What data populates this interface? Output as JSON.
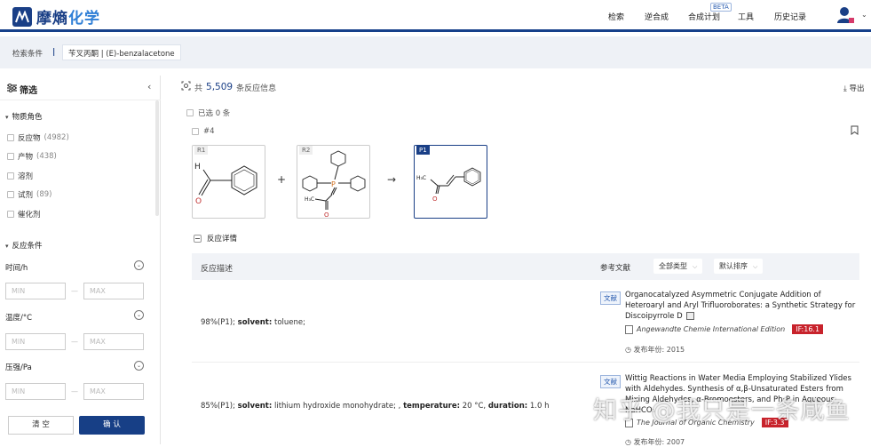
{
  "app": {
    "logo_main": "摩熵",
    "logo_accent": "化学"
  },
  "nav": {
    "search": "检索",
    "synthesis": "逆合成",
    "plan": "合成计划",
    "beta": "BETA",
    "tools": "工具",
    "history": "历史记录"
  },
  "search": {
    "label": "检索条件",
    "separator": "|",
    "query": "苄叉丙酮 | (E)-benzalacetone"
  },
  "sidebar": {
    "title": "筛选",
    "role_title": "物质角色",
    "roles": [
      {
        "label": "反应物",
        "count": "(4982)"
      },
      {
        "label": "产物",
        "count": "(438)"
      },
      {
        "label": "溶剂",
        "count": ""
      },
      {
        "label": "试剂",
        "count": "(89)"
      },
      {
        "label": "催化剂",
        "count": ""
      }
    ],
    "cond_title": "反应条件",
    "fields": [
      {
        "label": "时间/h",
        "min": "MIN",
        "max": "MAX"
      },
      {
        "label": "温度/°C",
        "min": "MIN",
        "max": "MAX"
      },
      {
        "label": "压强/Pa",
        "min": "MIN",
        "max": "MAX"
      }
    ],
    "dash": "—",
    "clear": "清 空",
    "confirm": "确 认"
  },
  "main": {
    "summary_prefix": "共",
    "summary_count": "5,509",
    "summary_suffix": "条反应信息",
    "export": "导出",
    "selected": "已选 0 条",
    "reaction_id": "#4",
    "r1": "R1",
    "r2": "R2",
    "p1": "P1",
    "plus": "+",
    "arrow": "→",
    "details_title": "反应详情",
    "table": {
      "col_desc": "反应描述",
      "col_ref": "参考文献",
      "filter_type": "全部类型",
      "filter_sort": "默认排序"
    },
    "rows": [
      {
        "yield": "98%(P1);",
        "solvent_label": "solvent:",
        "solvent": "toluene;",
        "doc_badge": "文献",
        "ref_title": "Organocatalyzed Asymmetric Conjugate Addition of Heteroaryl and Aryl Trifluoroborates: a Synthetic Strategy for Discoipyrrole D",
        "journal": "Angewandte Chemie International Edition",
        "impact": "IF:16.1",
        "year_label": "发布年份:",
        "year": "2015"
      },
      {
        "yield": "85%(P1);",
        "solvent_label": "solvent:",
        "solvent": "lithium hydroxide monohydrate; ,",
        "temp_label": "temperature:",
        "temp": "20 °C,",
        "duration_label": "duration:",
        "duration": "1.0 h",
        "doc_badge": "文献",
        "ref_title": "Wittig Reactions in Water Media Employing Stabilized Ylides with Aldehydes. Synthesis of α,β-Unsaturated Esters from Mixing Aldehydes, α-Bromoesters, and Ph₃P in Aqueous NaHCO₃",
        "journal": "The Journal of Organic Chemistry",
        "impact": "IF:3.3",
        "year_label": "发布年份:",
        "year": "2007"
      }
    ],
    "watermark": "知乎 @我只是一条咸鱼"
  },
  "colors": {
    "brand": "#1a3f86",
    "accent": "#2f7fd6",
    "impact": "#c8232c"
  }
}
